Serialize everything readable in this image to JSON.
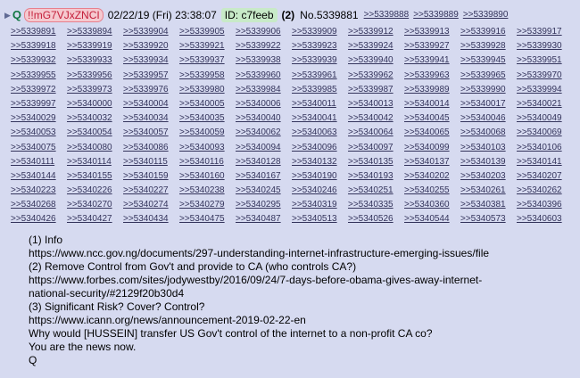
{
  "header": {
    "name": "Q",
    "tripcode": "!!mG7VJxZNCI",
    "date": "02/22/19 (Fri) 23:38:07",
    "id_label": "ID: c7feeb",
    "count": "(2)",
    "post_no": "No.5339881",
    "inline_links": [
      ">>5339888",
      ">>5339889",
      ">>5339890"
    ]
  },
  "replies": [
    ">>5339891",
    ">>5339894",
    ">>5339904",
    ">>5339905",
    ">>5339906",
    ">>5339909",
    ">>5339912",
    ">>5339913",
    ">>5339916",
    ">>5339917",
    ">>5339918",
    ">>5339919",
    ">>5339920",
    ">>5339921",
    ">>5339922",
    ">>5339923",
    ">>5339924",
    ">>5339927",
    ">>5339928",
    ">>5339930",
    ">>5339932",
    ">>5339933",
    ">>5339934",
    ">>5339937",
    ">>5339938",
    ">>5339939",
    ">>5339940",
    ">>5339941",
    ">>5339945",
    ">>5339951",
    ">>5339955",
    ">>5339956",
    ">>5339957",
    ">>5339958",
    ">>5339960",
    ">>5339961",
    ">>5339962",
    ">>5339963",
    ">>5339965",
    ">>5339970",
    ">>5339972",
    ">>5339973",
    ">>5339976",
    ">>5339980",
    ">>5339984",
    ">>5339985",
    ">>5339987",
    ">>5339989",
    ">>5339990",
    ">>5339994",
    ">>5339997",
    ">>5340000",
    ">>5340004",
    ">>5340005",
    ">>5340006",
    ">>5340011",
    ">>5340013",
    ">>5340014",
    ">>5340017",
    ">>5340021",
    ">>5340029",
    ">>5340032",
    ">>5340034",
    ">>5340035",
    ">>5340040",
    ">>5340041",
    ">>5340042",
    ">>5340045",
    ">>5340046",
    ">>5340049",
    ">>5340053",
    ">>5340054",
    ">>5340057",
    ">>5340059",
    ">>5340062",
    ">>5340063",
    ">>5340064",
    ">>5340065",
    ">>5340068",
    ">>5340069",
    ">>5340075",
    ">>5340080",
    ">>5340086",
    ">>5340093",
    ">>5340094",
    ">>5340096",
    ">>5340097",
    ">>5340099",
    ">>5340103",
    ">>5340106",
    ">>5340111",
    ">>5340114",
    ">>5340115",
    ">>5340116",
    ">>5340128",
    ">>5340132",
    ">>5340135",
    ">>5340137",
    ">>5340139",
    ">>5340141",
    ">>5340144",
    ">>5340155",
    ">>5340159",
    ">>5340160",
    ">>5340167",
    ">>5340190",
    ">>5340193",
    ">>5340202",
    ">>5340203",
    ">>5340207",
    ">>5340223",
    ">>5340226",
    ">>5340227",
    ">>5340238",
    ">>5340245",
    ">>5340246",
    ">>5340251",
    ">>5340255",
    ">>5340261",
    ">>5340262",
    ">>5340268",
    ">>5340270",
    ">>5340274",
    ">>5340279",
    ">>5340295",
    ">>5340319",
    ">>5340335",
    ">>5340360",
    ">>5340381",
    ">>5340396",
    ">>5340426",
    ">>5340427",
    ">>5340434",
    ">>5340475",
    ">>5340487",
    ">>5340513",
    ">>5340526",
    ">>5340544",
    ">>5340573",
    ">>5340603"
  ],
  "body": {
    "lines": [
      "(1) Info",
      "https://www.ncc.gov.ng/documents/297-understanding-internet-infrastructure-emerging-issues/file",
      "(2) Remove Control from Gov't and provide to CA (who controls CA?)",
      "https://www.forbes.com/sites/jodywestby/2016/09/24/7-days-before-obama-gives-away-internet-",
      "national-security/#2129f20b30d4",
      "(3) Significant Risk? Cover? Control?",
      "https://www.icann.org/news/announcement-2019-02-22-en",
      "Why would [HUSSEIN] transfer US Gov't control of the internet to a non-profit CA co?",
      "You are the news now.",
      "Q"
    ]
  },
  "colors": {
    "background": "#d6daf0",
    "name": "#117743",
    "link": "#34345c",
    "trip": "#c41e3a"
  }
}
